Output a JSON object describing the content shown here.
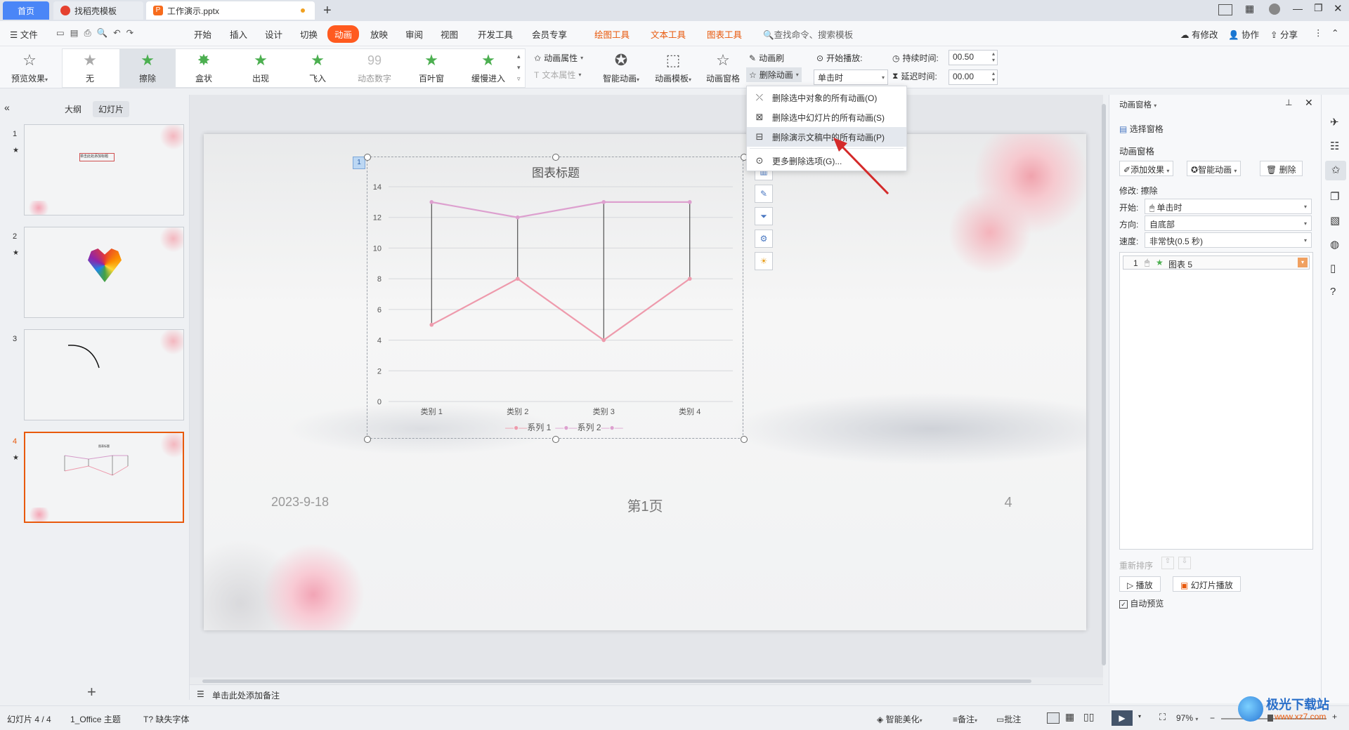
{
  "tabs": [
    {
      "label": "首页"
    },
    {
      "label": "找稻壳模板"
    },
    {
      "label": "工作演示.pptx"
    }
  ],
  "menu": {
    "file": "文件",
    "items": [
      "开始",
      "插入",
      "设计",
      "切换",
      "动画",
      "放映",
      "审阅",
      "视图",
      "开发工具",
      "会员专享"
    ],
    "context_tools": [
      "绘图工具",
      "文本工具",
      "图表工具"
    ],
    "search": "查找命令、搜索模板",
    "right": [
      "有修改",
      "协作",
      "分享"
    ]
  },
  "ribbon": {
    "preview": "预览效果",
    "effects": [
      "无",
      "擦除",
      "盒状",
      "出现",
      "飞入",
      "动态数字",
      "百叶窗",
      "缓慢进入"
    ],
    "anim_props": "动画属性",
    "text_props": "文本属性",
    "smart_anim": "智能动画",
    "anim_template": "动画模板",
    "anim_pane": "动画窗格",
    "anim_brush": "动画刷",
    "delete_anim": "删除动画",
    "start_play": "开始播放:",
    "start_value": "单击时",
    "duration_label": "持续时间:",
    "duration_value": "00.50",
    "delay_label": "延迟时间:",
    "delay_value": "00.00"
  },
  "dropdown": [
    {
      "label": "删除选中对象的所有动画(O)",
      "icon": "delete-object-anim-icon"
    },
    {
      "label": "删除选中幻灯片的所有动画(S)",
      "icon": "delete-slide-anim-icon"
    },
    {
      "label": "删除演示文稿中的所有动画(P)",
      "icon": "delete-all-anim-icon"
    },
    {
      "label": "更多删除选项(G)...",
      "icon": "more-options-icon"
    }
  ],
  "left_panel": {
    "tabs": [
      "大纲",
      "幻灯片"
    ],
    "slides": [
      {
        "num": "1",
        "caption": "单击此处添加标题"
      },
      {
        "num": "2",
        "caption": ""
      },
      {
        "num": "3",
        "caption": ""
      },
      {
        "num": "4",
        "caption": "图表标题"
      }
    ]
  },
  "slide": {
    "date": "2023-9-18",
    "footer": "第1页",
    "page_num": "4",
    "tag": "1",
    "notes_placeholder": "单击此处添加备注"
  },
  "chart_data": {
    "type": "line",
    "title": "图表标题",
    "categories": [
      "类别 1",
      "类别 2",
      "类别 3",
      "类别 4"
    ],
    "series": [
      {
        "name": "系列 1",
        "values": [
          5,
          8,
          4,
          8
        ],
        "color": "#ee9aac"
      },
      {
        "name": "系列 2",
        "values": [
          13,
          12,
          13,
          13
        ],
        "color": "#dda0cf"
      }
    ],
    "ylim": [
      0,
      14
    ],
    "yticks": [
      "0",
      "2",
      "4",
      "6",
      "8",
      "10",
      "12",
      "14"
    ],
    "high_low_lines": true,
    "legend": "bottom",
    "grid": true
  },
  "right_panel": {
    "title": "动画窗格",
    "select_pane": "选择窗格",
    "section": "动画窗格",
    "add_effect": "添加效果",
    "smart_anim": "智能动画",
    "delete": "删除",
    "modify": "修改: 擦除",
    "start_label": "开始:",
    "start_value": "单击时",
    "direction_label": "方向:",
    "direction_value": "自底部",
    "speed_label": "速度:",
    "speed_value": "非常快(0.5 秒)",
    "list_item_num": "1",
    "list_item_name": "图表 5",
    "reorder": "重新排序",
    "play": "播放",
    "slide_play": "幻灯片播放",
    "autopreview": "自动预览"
  },
  "status": {
    "slide_info": "幻灯片 4 / 4",
    "theme": "1_Office 主题",
    "missing_font": "缺失字体",
    "beautify": "智能美化",
    "notes": "备注",
    "comments": "批注",
    "zoom": "97%"
  },
  "watermark": "极光下载站",
  "watermark_url": "www.xz7.com",
  "colors": {
    "accent": "#e8590c",
    "green": "#4caf50",
    "active_tab": "#ff5a1f"
  }
}
